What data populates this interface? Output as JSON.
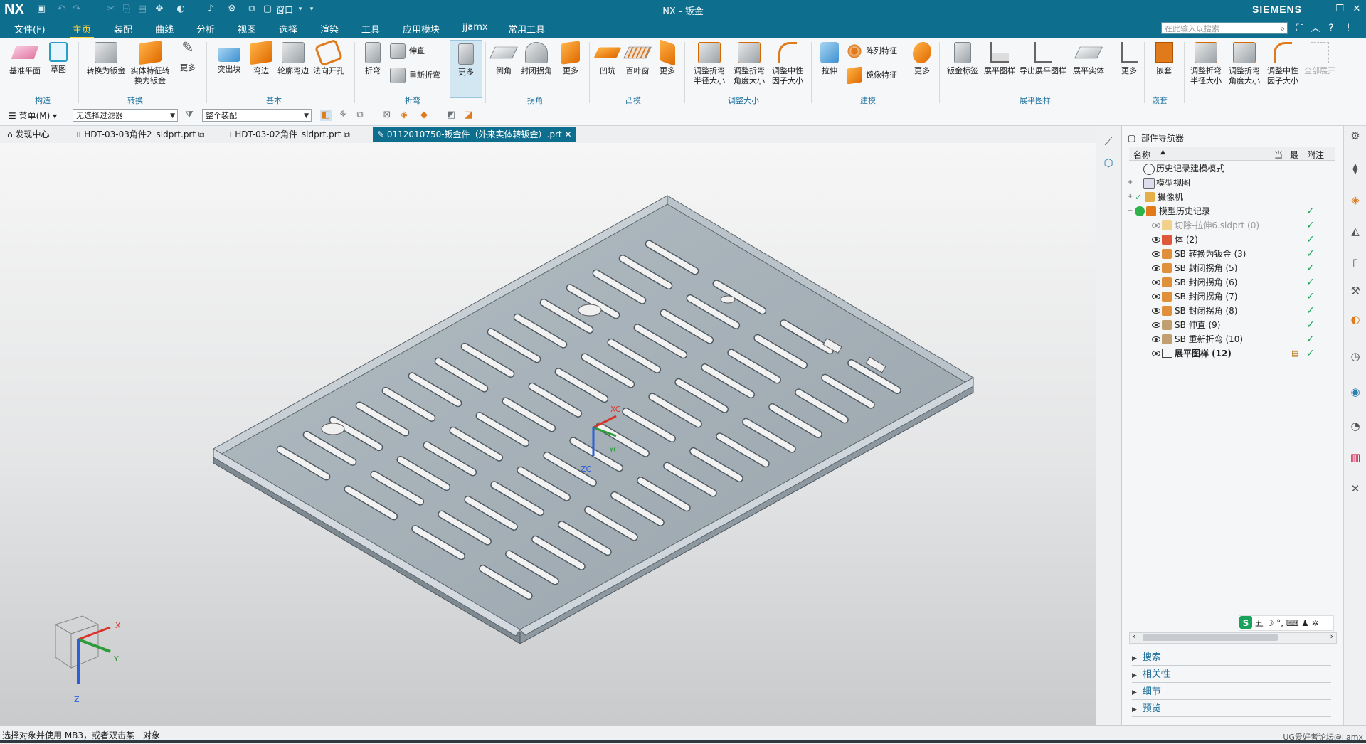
{
  "titlebar": {
    "logo": "NX",
    "title": "NX - 钣金",
    "brand": "SIEMENS",
    "window_menu": "窗口"
  },
  "menubar": {
    "items": [
      "文件(F)",
      "主页",
      "装配",
      "曲线",
      "分析",
      "视图",
      "选择",
      "渲染",
      "工具",
      "应用模块",
      "jjamx",
      "常用工具"
    ],
    "active_index": 1,
    "search_placeholder": "在此输入以搜索"
  },
  "ribbon": {
    "buttons": {
      "datum_plane": "基准平面",
      "sketch": "草图",
      "convert": "转换为钣金",
      "convert_solid": "实体特征转\n换为钣金",
      "more1": "更多",
      "tab": "突出块",
      "flange": "弯边",
      "contour_flange": "轮廓弯边",
      "normal_cutout": "法向开孔",
      "bend": "折弯",
      "unbend": "伸直",
      "rebend": "重新折弯",
      "more2": "更多",
      "chamfer": "倒角",
      "closed_corner": "封闭拐角",
      "more3": "更多",
      "dimple": "凹坑",
      "louver": "百叶窗",
      "more4": "更多",
      "resize_bend_radius": "调整折弯\n半径大小",
      "resize_bend_angle": "调整折弯\n角度大小",
      "resize_neutral": "调整中性\n因子大小",
      "extrude": "拉伸",
      "pattern": "阵列特征",
      "mirror": "镜像特征",
      "more5": "更多",
      "sm_label": "钣金标签",
      "flat_pattern": "展平图样",
      "export_flat": "导出展平图样",
      "flat_solid": "展平实体",
      "more6": "更多",
      "nest": "嵌套",
      "resize_bend_radius2": "调整折弯\n半径大小",
      "resize_bend_angle2": "调整折弯\n角度大小",
      "resize_neutral2": "调整中性\n因子大小",
      "unfold_all": "全部展开"
    },
    "groups": [
      "构造",
      "转换",
      "基本",
      "折弯",
      "拐角",
      "凸模",
      "调整大小",
      "建模",
      "展平图样",
      "嵌套"
    ]
  },
  "toolbar2": {
    "menu_label": "菜单(M)",
    "filter": "无选择过滤器",
    "scope": "整个装配"
  },
  "tabs": [
    {
      "label": "发现中心",
      "active": false
    },
    {
      "label": "HDT-03-03角件2_sldprt.prt",
      "active": false
    },
    {
      "label": "HDT-03-02角件_sldprt.prt",
      "active": false
    },
    {
      "label": "0112010750-钣金件（外来实体转钣金）.prt",
      "active": true
    }
  ],
  "viewport": {
    "wcs": {
      "xc": "XC",
      "yc": "YC",
      "zc": "ZC"
    },
    "triad": {
      "x": "X",
      "y": "Y",
      "z": "Z"
    }
  },
  "navigator": {
    "title": "部件导航器",
    "columns": {
      "name": "名称",
      "current": "当",
      "latest": "最",
      "note": "附注"
    },
    "rows": [
      {
        "label": "历史记录建模模式",
        "bold": false,
        "dim": false,
        "check": false
      },
      {
        "label": "模型视图",
        "bold": false,
        "dim": false,
        "check": false
      },
      {
        "label": "摄像机",
        "bold": false,
        "dim": false,
        "check": false
      },
      {
        "label": "模型历史记录",
        "bold": false,
        "dim": false,
        "check": true
      },
      {
        "label": "切除-拉伸6.sldprt (0)",
        "bold": false,
        "dim": true,
        "check": true
      },
      {
        "label": "体 (2)",
        "bold": false,
        "dim": false,
        "check": true
      },
      {
        "label": "SB 转换为钣金 (3)",
        "bold": false,
        "dim": false,
        "check": true
      },
      {
        "label": "SB 封闭拐角 (5)",
        "bold": false,
        "dim": false,
        "check": true
      },
      {
        "label": "SB 封闭拐角 (6)",
        "bold": false,
        "dim": false,
        "check": true
      },
      {
        "label": "SB 封闭拐角 (7)",
        "bold": false,
        "dim": false,
        "check": true
      },
      {
        "label": "SB 封闭拐角 (8)",
        "bold": false,
        "dim": false,
        "check": true
      },
      {
        "label": "SB 伸直 (9)",
        "bold": false,
        "dim": false,
        "check": true
      },
      {
        "label": "SB 重新折弯 (10)",
        "bold": false,
        "dim": false,
        "check": true
      },
      {
        "label": "展平图样 (12)",
        "bold": true,
        "dim": false,
        "check": true
      }
    ],
    "check_glyph": "✓",
    "accordion": [
      "搜索",
      "相关性",
      "细节",
      "预览"
    ],
    "ime": "五"
  },
  "status": {
    "message": "选择对象并使用 MB3，或者双击某一对象",
    "watermark": "UG爱好者论坛@jjamx"
  },
  "colors": {
    "accent": "#0e6e8e",
    "active_menu": "#ffd23f",
    "check": "#19a35a",
    "link": "#1c6f9b"
  }
}
